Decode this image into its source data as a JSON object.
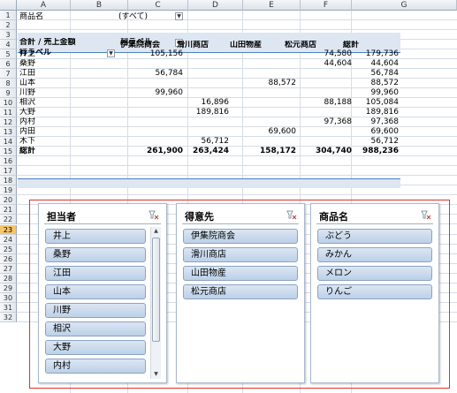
{
  "columns": [
    "A",
    "B",
    "C",
    "D",
    "E",
    "F",
    "G"
  ],
  "rows": [
    "1",
    "2",
    "3",
    "4",
    "5",
    "6",
    "7",
    "8",
    "9",
    "10",
    "11",
    "12",
    "13",
    "14",
    "15",
    "16",
    "17",
    "18",
    "19",
    "20",
    "21",
    "22",
    "23",
    "24",
    "25",
    "26",
    "27",
    "28",
    "29",
    "30",
    "31",
    "32"
  ],
  "selected_row": "23",
  "filter": {
    "label": "商品名",
    "value": "(すべて)"
  },
  "pivot": {
    "value_label": "合計 / 売上金額",
    "col_label": "列ラベル",
    "row_label": "行ラベル",
    "col_headers": [
      "伊集院商会",
      "滑川商店",
      "山田物産",
      "松元商店",
      "総計"
    ],
    "rows": [
      {
        "name": "井上",
        "v": [
          "105,156",
          "",
          "",
          "74,580",
          "179,736"
        ]
      },
      {
        "name": "桑野",
        "v": [
          "",
          "",
          "",
          "44,604",
          "44,604"
        ]
      },
      {
        "name": "江田",
        "v": [
          "56,784",
          "",
          "",
          "",
          "56,784"
        ]
      },
      {
        "name": "山本",
        "v": [
          "",
          "",
          "88,572",
          "",
          "88,572"
        ]
      },
      {
        "name": "川野",
        "v": [
          "99,960",
          "",
          "",
          "",
          "99,960"
        ]
      },
      {
        "name": "相沢",
        "v": [
          "",
          "16,896",
          "",
          "88,188",
          "105,084"
        ]
      },
      {
        "name": "大野",
        "v": [
          "",
          "189,816",
          "",
          "",
          "189,816"
        ]
      },
      {
        "name": "内村",
        "v": [
          "",
          "",
          "",
          "97,368",
          "97,368"
        ]
      },
      {
        "name": "内田",
        "v": [
          "",
          "",
          "69,600",
          "",
          "69,600"
        ]
      },
      {
        "name": "木下",
        "v": [
          "",
          "56,712",
          "",
          "",
          "56,712"
        ]
      }
    ],
    "total": {
      "name": "総計",
      "v": [
        "261,900",
        "263,424",
        "158,172",
        "304,740",
        "988,236"
      ]
    }
  },
  "slicers": {
    "person": {
      "title": "担当者",
      "items": [
        "井上",
        "桑野",
        "江田",
        "山本",
        "川野",
        "相沢",
        "大野",
        "内村"
      ]
    },
    "customer": {
      "title": "得意先",
      "items": [
        "伊集院商会",
        "滑川商店",
        "山田物産",
        "松元商店"
      ]
    },
    "product": {
      "title": "商品名",
      "items": [
        "ぶどう",
        "みかん",
        "メロン",
        "りんご"
      ]
    }
  },
  "colors": {
    "slicer_item": "#c6d7ec",
    "frame": "#e03030",
    "header_band": "#dde6f1"
  }
}
